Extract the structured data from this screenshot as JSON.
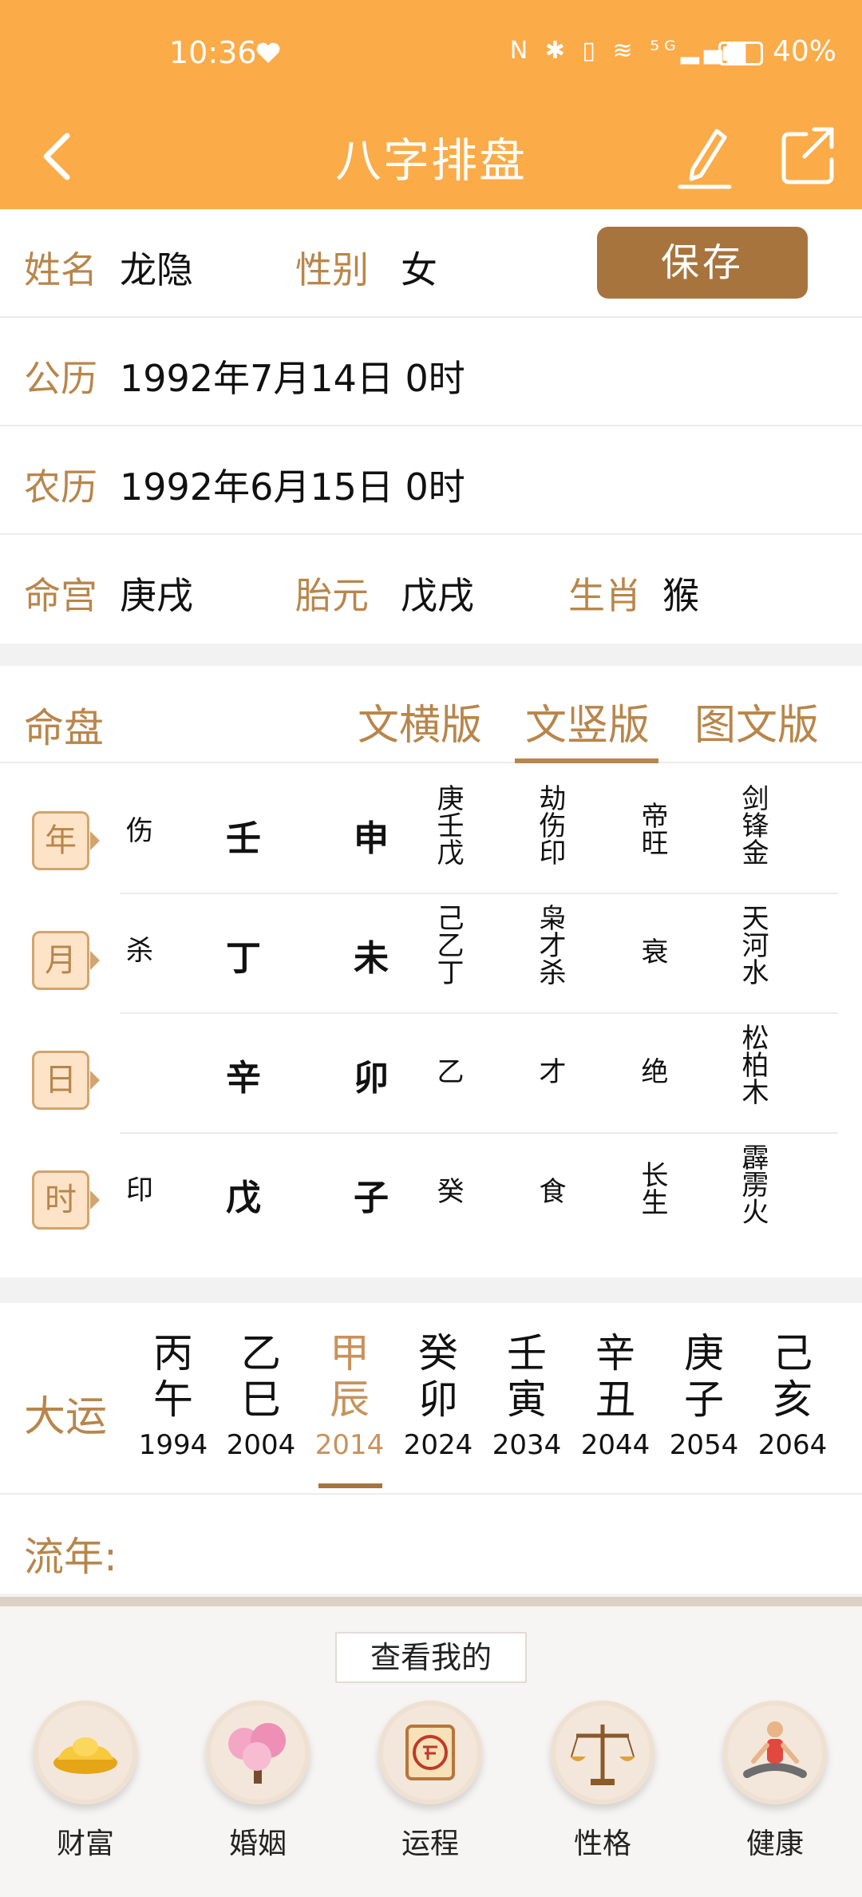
{
  "status": {
    "time": "10:36",
    "indicators": "N ✱ ▯ ≋ ⁵ᴳ▂▄▆",
    "battery": "40%"
  },
  "app_bar": {
    "title": "八字排盘"
  },
  "info": {
    "name_label": "姓名",
    "name": "龙隐",
    "gender_label": "性别",
    "gender": "女",
    "save": "保存",
    "solar_label": "公历",
    "solar": "1992年7月14日 0时",
    "lunar_label": "农历",
    "lunar": "1992年6月15日 0时",
    "minggong_label": "命宫",
    "minggong": "庚戌",
    "taiyuan_label": "胎元",
    "taiyuan": "戊戌",
    "zodiac_label": "生肖",
    "zodiac": "猴"
  },
  "chart": {
    "title": "命盘",
    "tabs": [
      "文横版",
      "文竖版",
      "图文版"
    ],
    "active_tab": 1,
    "pillars": [
      {
        "tag": "年",
        "shishen": "伤",
        "stem": "壬",
        "branch": "申",
        "hidden": "庚壬戊",
        "hidden_gods": "劫伤印",
        "phase": "帝旺",
        "nayin": "剑锋金"
      },
      {
        "tag": "月",
        "shishen": "杀",
        "stem": "丁",
        "branch": "未",
        "hidden": "己乙丁",
        "hidden_gods": "枭才杀",
        "phase": "衰",
        "nayin": "天河水"
      },
      {
        "tag": "日",
        "shishen": "",
        "stem": "辛",
        "branch": "卯",
        "hidden": "乙",
        "hidden_gods": "才",
        "phase": "绝",
        "nayin": "松柏木"
      },
      {
        "tag": "时",
        "shishen": "印",
        "stem": "戊",
        "branch": "子",
        "hidden": "癸",
        "hidden_gods": "食",
        "phase": "长生",
        "nayin": "霹雳火"
      }
    ]
  },
  "dayun": {
    "label": "大运",
    "items": [
      {
        "stem": "丙",
        "branch": "午",
        "year": "1994"
      },
      {
        "stem": "乙",
        "branch": "巳",
        "year": "2004"
      },
      {
        "stem": "甲",
        "branch": "辰",
        "year": "2014"
      },
      {
        "stem": "癸",
        "branch": "卯",
        "year": "2024"
      },
      {
        "stem": "壬",
        "branch": "寅",
        "year": "2034"
      },
      {
        "stem": "辛",
        "branch": "丑",
        "year": "2044"
      },
      {
        "stem": "庚",
        "branch": "子",
        "year": "2054"
      },
      {
        "stem": "己",
        "branch": "亥",
        "year": "2064"
      }
    ],
    "active_index": 2
  },
  "liunian": {
    "label": "流年:"
  },
  "bottom": {
    "check_label": "查看我的",
    "features": [
      {
        "label": "财富",
        "icon": "gold-ingot-icon"
      },
      {
        "label": "婚姻",
        "icon": "blossom-tree-icon"
      },
      {
        "label": "运程",
        "icon": "fortune-scroll-icon"
      },
      {
        "label": "性格",
        "icon": "scales-icon"
      },
      {
        "label": "健康",
        "icon": "yoga-icon"
      }
    ]
  },
  "colors": {
    "accent": "#fbab48",
    "gold": "#b8864b",
    "save": "#a8743e"
  }
}
